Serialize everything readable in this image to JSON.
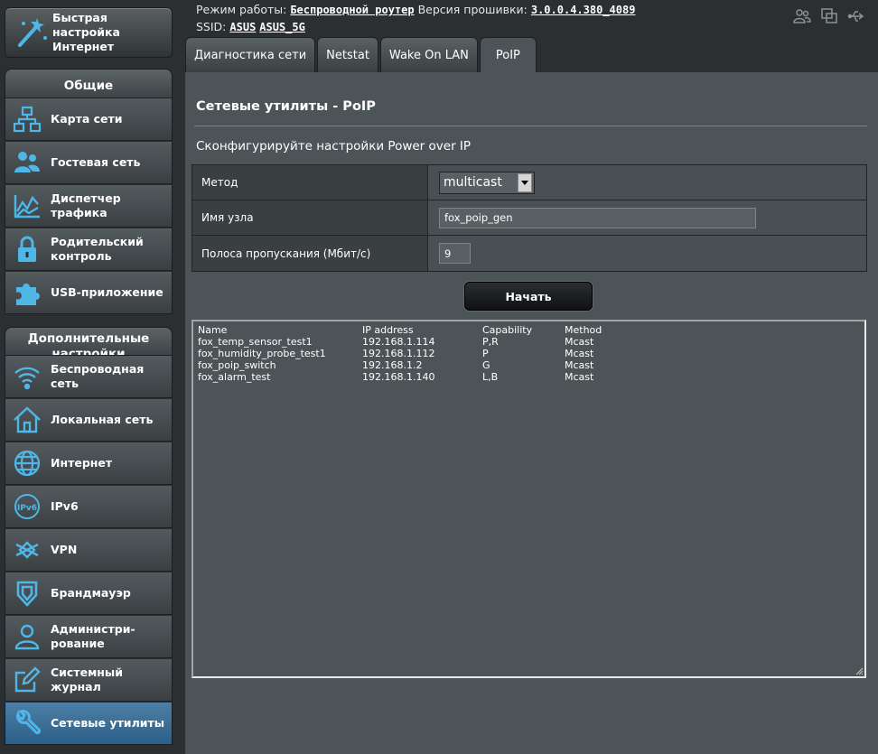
{
  "header": {
    "mode_label": "Режим работы:",
    "mode_value": "Беспроводной роутер",
    "firmware_label": "Версия прошивки:",
    "firmware_value": "3.0.0.4.380_4089",
    "ssid_label": "SSID:",
    "ssid_1": "ASUS",
    "ssid_2": "ASUS_5G",
    "icons": [
      "clients-icon",
      "copy-icon",
      "usb-icon"
    ]
  },
  "sidebar": {
    "quick_setup": {
      "label": "Быстрая настройка Интернет",
      "icon": "magic-wand-icon"
    },
    "general_heading": "Общие",
    "general_items": [
      {
        "label": "Карта сети",
        "icon": "network-map-icon"
      },
      {
        "label": "Гостевая сеть",
        "icon": "guest-network-icon"
      },
      {
        "label": "Диспетчер трафика",
        "icon": "traffic-manager-icon"
      },
      {
        "label": "Родительский контроль",
        "icon": "parental-lock-icon"
      },
      {
        "label": "USB-приложение",
        "icon": "puzzle-icon"
      }
    ],
    "advanced_heading": "Дополнительные настройки",
    "advanced_items": [
      {
        "label": "Беспроводная сеть",
        "icon": "wifi-icon"
      },
      {
        "label": "Локальная сеть",
        "icon": "home-icon"
      },
      {
        "label": "Интернет",
        "icon": "globe-icon"
      },
      {
        "label": "IPv6",
        "icon": "ipv6-icon"
      },
      {
        "label": "VPN",
        "icon": "vpn-icon"
      },
      {
        "label": "Брандмауэр",
        "icon": "shield-icon"
      },
      {
        "label": "Администри-рование",
        "icon": "admin-user-icon"
      },
      {
        "label": "Системный журнал",
        "icon": "log-edit-icon"
      },
      {
        "label": "Сетевые утилиты",
        "icon": "wrench-icon"
      }
    ]
  },
  "tabs": [
    {
      "label": "Диагностика сети"
    },
    {
      "label": "Netstat"
    },
    {
      "label": "Wake On LAN"
    },
    {
      "label": "PoIP"
    }
  ],
  "main": {
    "title": "Сетевые утилиты - PoIP",
    "description": "Сконфигурируйте настройки Power over IP",
    "form": {
      "method_label": "Метод",
      "method_value": "multicast",
      "hostname_label": "Имя узла",
      "hostname_value": "fox_poip_gen",
      "bandwidth_label": "Полоса пропускания (Мбит/с)",
      "bandwidth_value": "9"
    },
    "start_button": "Начать",
    "result": {
      "headers": [
        "Name",
        "IP address",
        "Capability",
        "Method"
      ],
      "rows": [
        [
          "fox_temp_sensor_test1",
          "192.168.1.114",
          "P,R",
          "Mcast"
        ],
        [
          "fox_humidity_probe_test1",
          "192.168.1.112",
          "P",
          "Mcast"
        ],
        [
          "fox_poip_switch",
          "192.168.1.2",
          "G",
          "Mcast"
        ],
        [
          "fox_alarm_test",
          "192.168.1.140",
          "L,B",
          "Mcast"
        ]
      ]
    }
  },
  "colors": {
    "accent_icon": "#4fb7e8",
    "active_item": "#3b6e96",
    "panel_bg": "#4d5457"
  }
}
